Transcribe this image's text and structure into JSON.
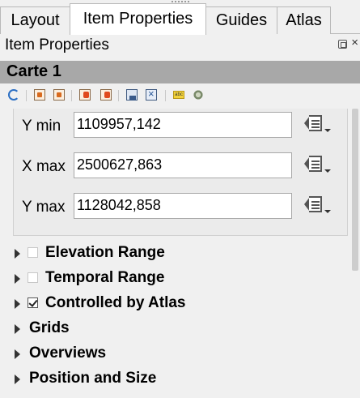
{
  "tabs": [
    {
      "label": "Layout",
      "active": false
    },
    {
      "label": "Item Properties",
      "active": true
    },
    {
      "label": "Guides",
      "active": false
    },
    {
      "label": "Atlas",
      "active": false
    }
  ],
  "panel": {
    "title": "Item Properties",
    "close_glyph": "×"
  },
  "item": {
    "name": "Carte 1"
  },
  "toolbar": {
    "icons": [
      "refresh-icon",
      "page-icon",
      "page-icon",
      "layout-icon",
      "layout-icon",
      "map-lock-icon",
      "zoom-icon",
      "label-icon",
      "gear-icon"
    ]
  },
  "extent": {
    "y_min": {
      "label": "Y min",
      "value": "1109957,142"
    },
    "x_max": {
      "label": "X max",
      "value": "2500627,863"
    },
    "y_max": {
      "label": "Y max",
      "value": "1128042,858"
    }
  },
  "groups": [
    {
      "label": "Elevation Range",
      "checkable": true,
      "checked": false
    },
    {
      "label": "Temporal Range",
      "checkable": true,
      "checked": false
    },
    {
      "label": "Controlled by Atlas",
      "checkable": true,
      "checked": true
    },
    {
      "label": "Grids",
      "checkable": false
    },
    {
      "label": "Overviews",
      "checkable": false
    },
    {
      "label": "Position and Size",
      "checkable": false
    }
  ],
  "colors": {
    "header_bg": "#a8a8a8",
    "panel_bg": "#f0f0f0",
    "active_tab_bg": "#ffffff"
  }
}
